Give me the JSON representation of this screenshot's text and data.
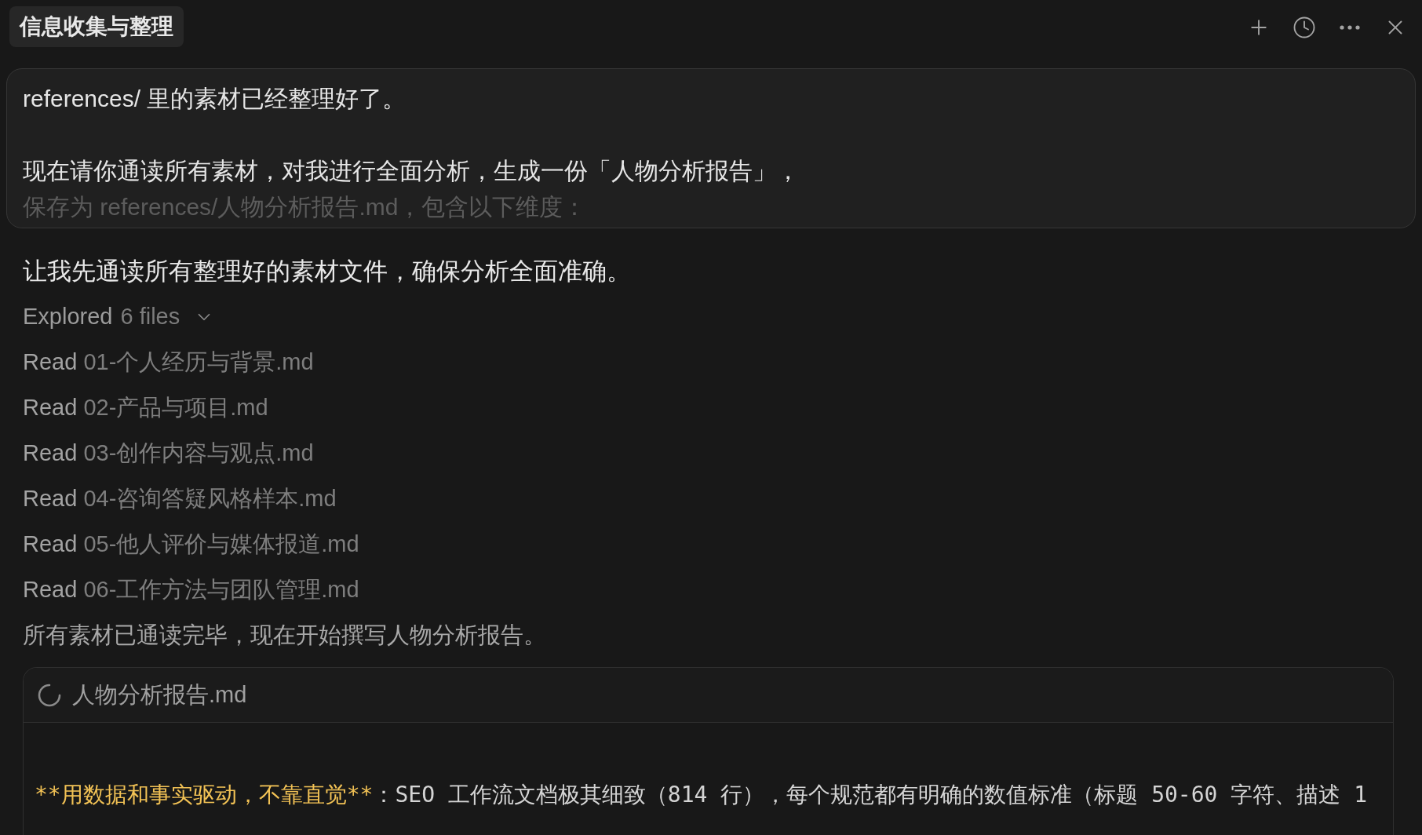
{
  "header": {
    "title": "信息收集与整理"
  },
  "user_message": {
    "collapsed": true,
    "paragraphs": [
      {
        "lines": [
          "references/ 里的素材已经整理好了。"
        ]
      },
      {
        "lines": [
          "现在请你通读所有素材，对我进行全面分析，生成一份「人物分析报告」，",
          "保存为 references/人物分析报告.md，包含以下维度："
        ]
      }
    ]
  },
  "assistant": {
    "intro": "让我先通读所有整理好的素材文件，确保分析全面准确。",
    "explored": {
      "label": "Explored",
      "count": "6 files",
      "expanded": true,
      "items": [
        {
          "verb": "Read",
          "file": "01-个人经历与背景.md"
        },
        {
          "verb": "Read",
          "file": "02-产品与项目.md"
        },
        {
          "verb": "Read",
          "file": "03-创作内容与观点.md"
        },
        {
          "verb": "Read",
          "file": "04-咨询答疑风格样本.md"
        },
        {
          "verb": "Read",
          "file": "05-他人评价与媒体报道.md"
        },
        {
          "verb": "Read",
          "file": "06-工作方法与团队管理.md"
        }
      ]
    },
    "summary": "所有素材已通读完毕，现在开始撰写人物分析报告。",
    "file_card": {
      "filename": "人物分析报告.md",
      "loading": true,
      "lines": [
        {
          "segments": [
            {
              "kind": "emphasis",
              "text": "**用数据和事实驱动，不靠直觉**"
            },
            {
              "kind": "plain",
              "text": "：SEO 工作流文档极其细致（814 行），每个规范都有明确的数值标准（标题 50-60 字符、描述 1"
            }
          ]
        }
      ]
    }
  }
}
